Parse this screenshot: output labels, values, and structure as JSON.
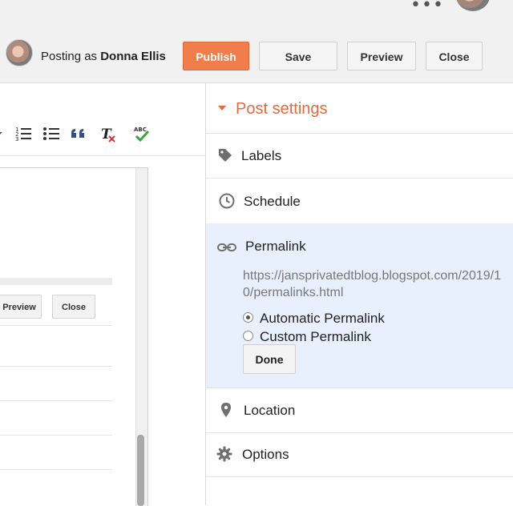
{
  "header": {
    "posting_prefix": "Posting as",
    "user_name": "Donna Ellis",
    "buttons": {
      "publish": "Publish",
      "save": "Save",
      "preview": "Preview",
      "close": "Close"
    }
  },
  "editor_preview": {
    "preview_label": "Preview",
    "close_label": "Close"
  },
  "post_settings": {
    "title": "Post settings",
    "items": {
      "labels": "Labels",
      "schedule": "Schedule",
      "permalink": "Permalink",
      "location": "Location",
      "options": "Options"
    },
    "permalink": {
      "url": "https://jansprivatedtblog.blogspot.com/2019/10/permalinks.html",
      "automatic_label": "Automatic Permalink",
      "custom_label": "Custom Permalink",
      "selected": "automatic",
      "done_label": "Done"
    }
  },
  "colors": {
    "accent": "#f07d4a",
    "title_orange": "#e8693c",
    "expanded_bg": "#e8f0fe"
  },
  "icons": {
    "toolbar": [
      "numbered-list-icon",
      "bulleted-list-icon",
      "quote-icon",
      "remove-formatting-icon",
      "spellcheck-icon"
    ],
    "settings": [
      "tag-icon",
      "clock-icon",
      "link-icon",
      "location-pin-icon",
      "gear-icon"
    ]
  }
}
